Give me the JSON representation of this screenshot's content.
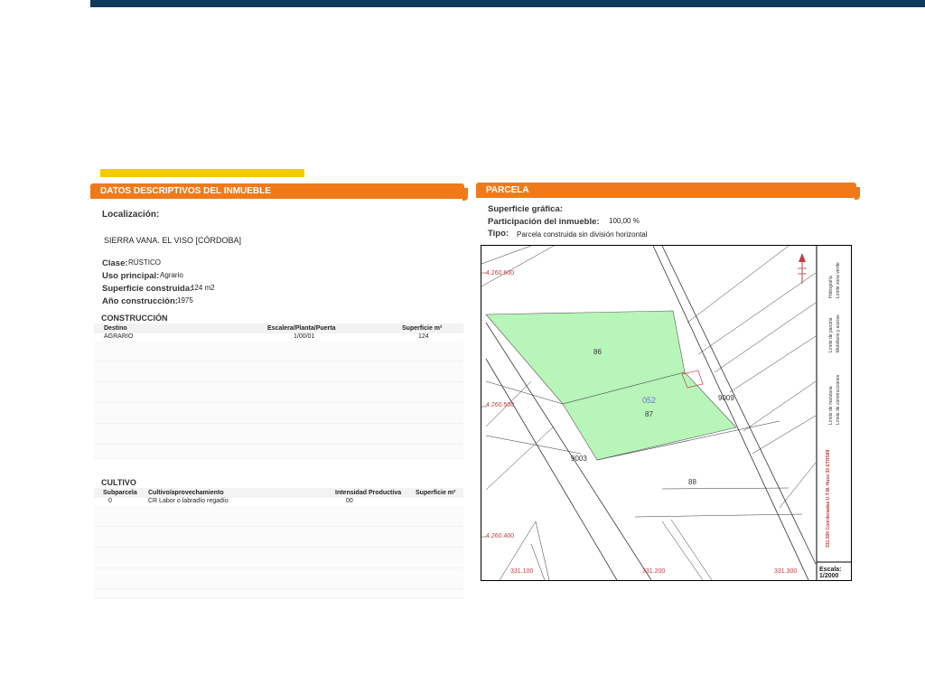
{
  "left_panel": {
    "title": "DATOS DESCRIPTIVOS DEL INMUEBLE",
    "localizacion_label": "Localización:",
    "localizacion_value": "SIERRA VANA. EL VISO [CÓRDOBA]",
    "clase_label": "Clase:",
    "clase_value": "RÚSTICO",
    "uso_label": "Uso principal:",
    "uso_value": "Agrario",
    "superficie_label": "Superficie construida:",
    "superficie_value": "124 m2",
    "anio_label": "Año construcción:",
    "anio_value": "1975",
    "construccion": {
      "title": "CONSTRUCCIÓN",
      "headers": [
        "Destino",
        "Escalera/Planta/Puerta",
        "Superficie m²"
      ],
      "rows": [
        [
          "AGRARIO",
          "1/00/01",
          "124"
        ]
      ]
    },
    "cultivo": {
      "title": "CULTIVO",
      "headers": [
        "Subparcela",
        "Cultivo/aprovechamiento",
        "Intensidad Productiva",
        "Superficie m²"
      ],
      "rows": [
        [
          "0",
          "CR Labor o labradío regadío",
          "00",
          ""
        ]
      ]
    }
  },
  "right_panel": {
    "title": "PARCELA",
    "superficie_label": "Superficie gráfica:",
    "participacion_label": "Participación del inmueble:",
    "participacion_value": "100,00 %",
    "tipo_label": "Tipo:",
    "tipo_value": "Parcela construida sin división horizontal",
    "map": {
      "y_coords": [
        "4.260.600",
        "4.260.500",
        "4.260.400"
      ],
      "x_coords": [
        "331.100",
        "331.200",
        "331.300"
      ],
      "parcel_labels": [
        "86",
        "052",
        "87",
        "88",
        "9003",
        "9009"
      ],
      "legend": [
        "Hidrografía",
        "Límite zona verde",
        "Límite de parcela",
        "Mobiliario y aceras",
        "Límite de manzana",
        "Límite de construcciones"
      ],
      "coords_note": "331.300 Coordenadas U.T.M. Huso 30 ETRS89",
      "scale_label": "Escala:",
      "scale_value": "1/2000",
      "colors": {
        "parcel_fill": "#b8f5b8",
        "coord_text": "#c04040",
        "highlight_label": "#7070d0"
      }
    }
  }
}
